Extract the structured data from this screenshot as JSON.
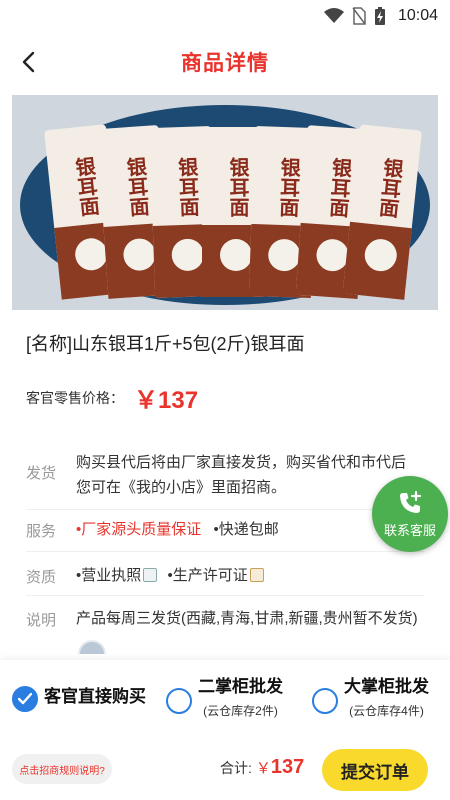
{
  "status_bar": {
    "time": "10:04",
    "icons": [
      "wifi-icon",
      "no-sim-icon",
      "battery-charging-icon"
    ]
  },
  "header": {
    "title": "商品详情",
    "back_icon": "chevron-left-icon"
  },
  "product": {
    "image_package_text": "银耳面",
    "name": "[名称]山东银耳1斤+5包(2斤)银耳面",
    "price_label": "客官零售价格：",
    "price": "￥137"
  },
  "info": {
    "shipping": {
      "label": "发货",
      "text": "购买县代后将由厂家直接发货，购买省代和市代后您可在《我的小店》里面招商。"
    },
    "service": {
      "label": "服务",
      "tags": [
        "•厂家源头质量保证",
        "•快递包邮"
      ]
    },
    "qualification": {
      "label": "资质",
      "tags": [
        "•营业执照",
        "•生产许可证"
      ]
    },
    "note": {
      "label": "说明",
      "text": "产品每周三发货(西藏,青海,甘肃,新疆,贵州暂不发货)"
    }
  },
  "fab": {
    "label": "联系客服",
    "icon": "phone-plus-icon"
  },
  "options": [
    {
      "title": "客官直接购买",
      "sub": "",
      "checked": true
    },
    {
      "title": "二掌柜批发",
      "sub": "(云仓库存2件)",
      "checked": false
    },
    {
      "title": "大掌柜批发",
      "sub": "(云仓库存4件)",
      "checked": false
    }
  ],
  "footer": {
    "rules_button": "点击招商规则说明?",
    "total_label": "合计:",
    "total_currency": "￥",
    "total_value": "137",
    "submit_label": "提交订单"
  },
  "colors": {
    "accent_red": "#e8342c",
    "fab_green": "#4caf50",
    "submit_yellow": "#f8d92c",
    "radio_blue": "#2a7de1"
  }
}
